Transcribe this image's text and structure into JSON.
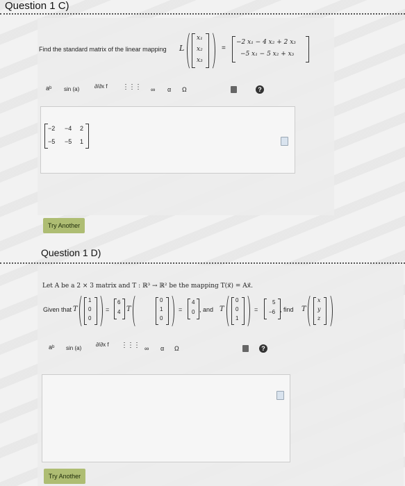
{
  "q1c": {
    "title": "Question 1 C)",
    "prompt": "Find the standard matrix of the linear mapping",
    "mapping_symbol": "L",
    "input_vector": [
      "x₁",
      "x₂",
      "x₃"
    ],
    "equals": "=",
    "output_rows": [
      "−2 x₁ − 4 x₂ + 2 x₃",
      "−5 x₁ − 5 x₂ + x₃"
    ],
    "answer_matrix": [
      [
        "−2",
        "−4",
        "2"
      ],
      [
        "−5",
        "−5",
        "1"
      ]
    ],
    "try_another": "Try Another"
  },
  "q1d": {
    "title": "Question 1 D)",
    "statement": "Let A be a 2 × 3 matrix and T : ℝ³ → ℝ² be the mapping T(x⃗) = Ax⃗.",
    "given_that": "Given that",
    "T": "T",
    "e1": [
      "1",
      "0",
      "0"
    ],
    "r1": [
      "6",
      "4"
    ],
    "e2": [
      "0",
      "1",
      "0"
    ],
    "r2": [
      "4",
      "0"
    ],
    "and": ", and",
    "e3": [
      "0",
      "0",
      "1"
    ],
    "r3": [
      "5",
      "−6"
    ],
    "find": ", find",
    "xyz": [
      "x",
      "y",
      "z"
    ],
    "try_another": "Try Another"
  },
  "toolbar": {
    "power": "aᵇ",
    "sin": "sin (a)",
    "partial": "∂/∂x f",
    "matrix": "⋮⋮⋮",
    "infinity": "∞",
    "alpha": "α",
    "omega": "Ω",
    "help": "?"
  },
  "icons": [
    "trash-icon",
    "help-icon",
    "file-icon"
  ]
}
